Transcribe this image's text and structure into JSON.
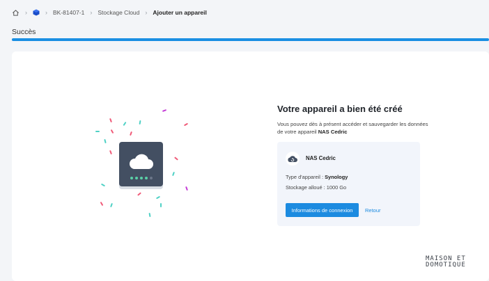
{
  "breadcrumb": {
    "items": [
      "BK-81407-1",
      "Stockage Cloud"
    ],
    "current": "Ajouter un appareil"
  },
  "page": {
    "title": "Succès",
    "progress": 1.0
  },
  "success": {
    "heading": "Votre appareil a bien été créé",
    "description_prefix": "Vous pouvez dès à présent accéder et sauvegarder les données de votre appareil ",
    "device_name_inline": "NAS Cedric"
  },
  "device": {
    "name": "NAS Cedric",
    "type_label": "Type d'appareil : ",
    "type_value": "Synology",
    "storage_label": "Stockage alloué : ",
    "storage_value": "1000 Go"
  },
  "actions": {
    "connection_info": "Informations de connexion",
    "back": "Retour"
  },
  "watermark": {
    "line1": "MAISON ET",
    "line2": "DOMOTIQUE"
  },
  "colors": {
    "accent": "#1c8be0",
    "nas_body": "#434f62"
  }
}
